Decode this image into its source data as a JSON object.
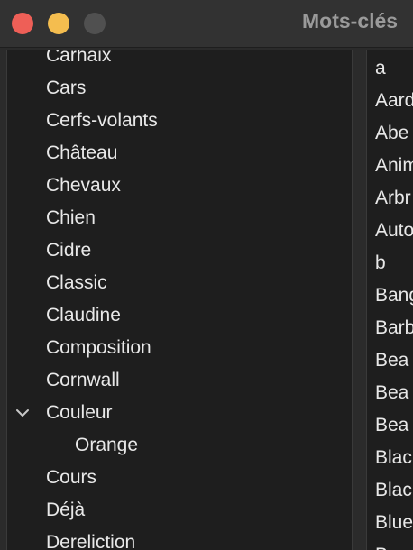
{
  "window": {
    "title": "Mots-clés"
  },
  "left_list": {
    "items": [
      {
        "label": "Carhaix"
      },
      {
        "label": "Cars"
      },
      {
        "label": "Cerfs-volants"
      },
      {
        "label": "Château"
      },
      {
        "label": "Chevaux"
      },
      {
        "label": "Chien"
      },
      {
        "label": "Cidre"
      },
      {
        "label": "Classic"
      },
      {
        "label": "Claudine"
      },
      {
        "label": "Composition"
      },
      {
        "label": "Cornwall"
      },
      {
        "label": "Couleur",
        "expanded": true,
        "icon": "chevron-down-icon"
      },
      {
        "label": "Orange",
        "child": true
      },
      {
        "label": "Cours"
      },
      {
        "label": "Déjà"
      },
      {
        "label": "Dereliction"
      }
    ]
  },
  "right_list": {
    "items": [
      {
        "label": "a"
      },
      {
        "label": "Aard"
      },
      {
        "label": "Abe"
      },
      {
        "label": "Anim"
      },
      {
        "label": "Arbr"
      },
      {
        "label": "Auto"
      },
      {
        "label": "b"
      },
      {
        "label": "Bang"
      },
      {
        "label": "Barb"
      },
      {
        "label": "Bea"
      },
      {
        "label": "Bea"
      },
      {
        "label": "Bea"
      },
      {
        "label": "Blac"
      },
      {
        "label": "Blac"
      },
      {
        "label": "Blue"
      },
      {
        "label": "Bro"
      }
    ]
  },
  "colors": {
    "close": "#ee5f57",
    "minimize": "#f4bd4f",
    "zoom": "#505050",
    "text": "#e8e8e8",
    "title": "#9a9a9a",
    "panel_bg": "#1e1e1e",
    "window_bg": "#2b2b2b"
  }
}
